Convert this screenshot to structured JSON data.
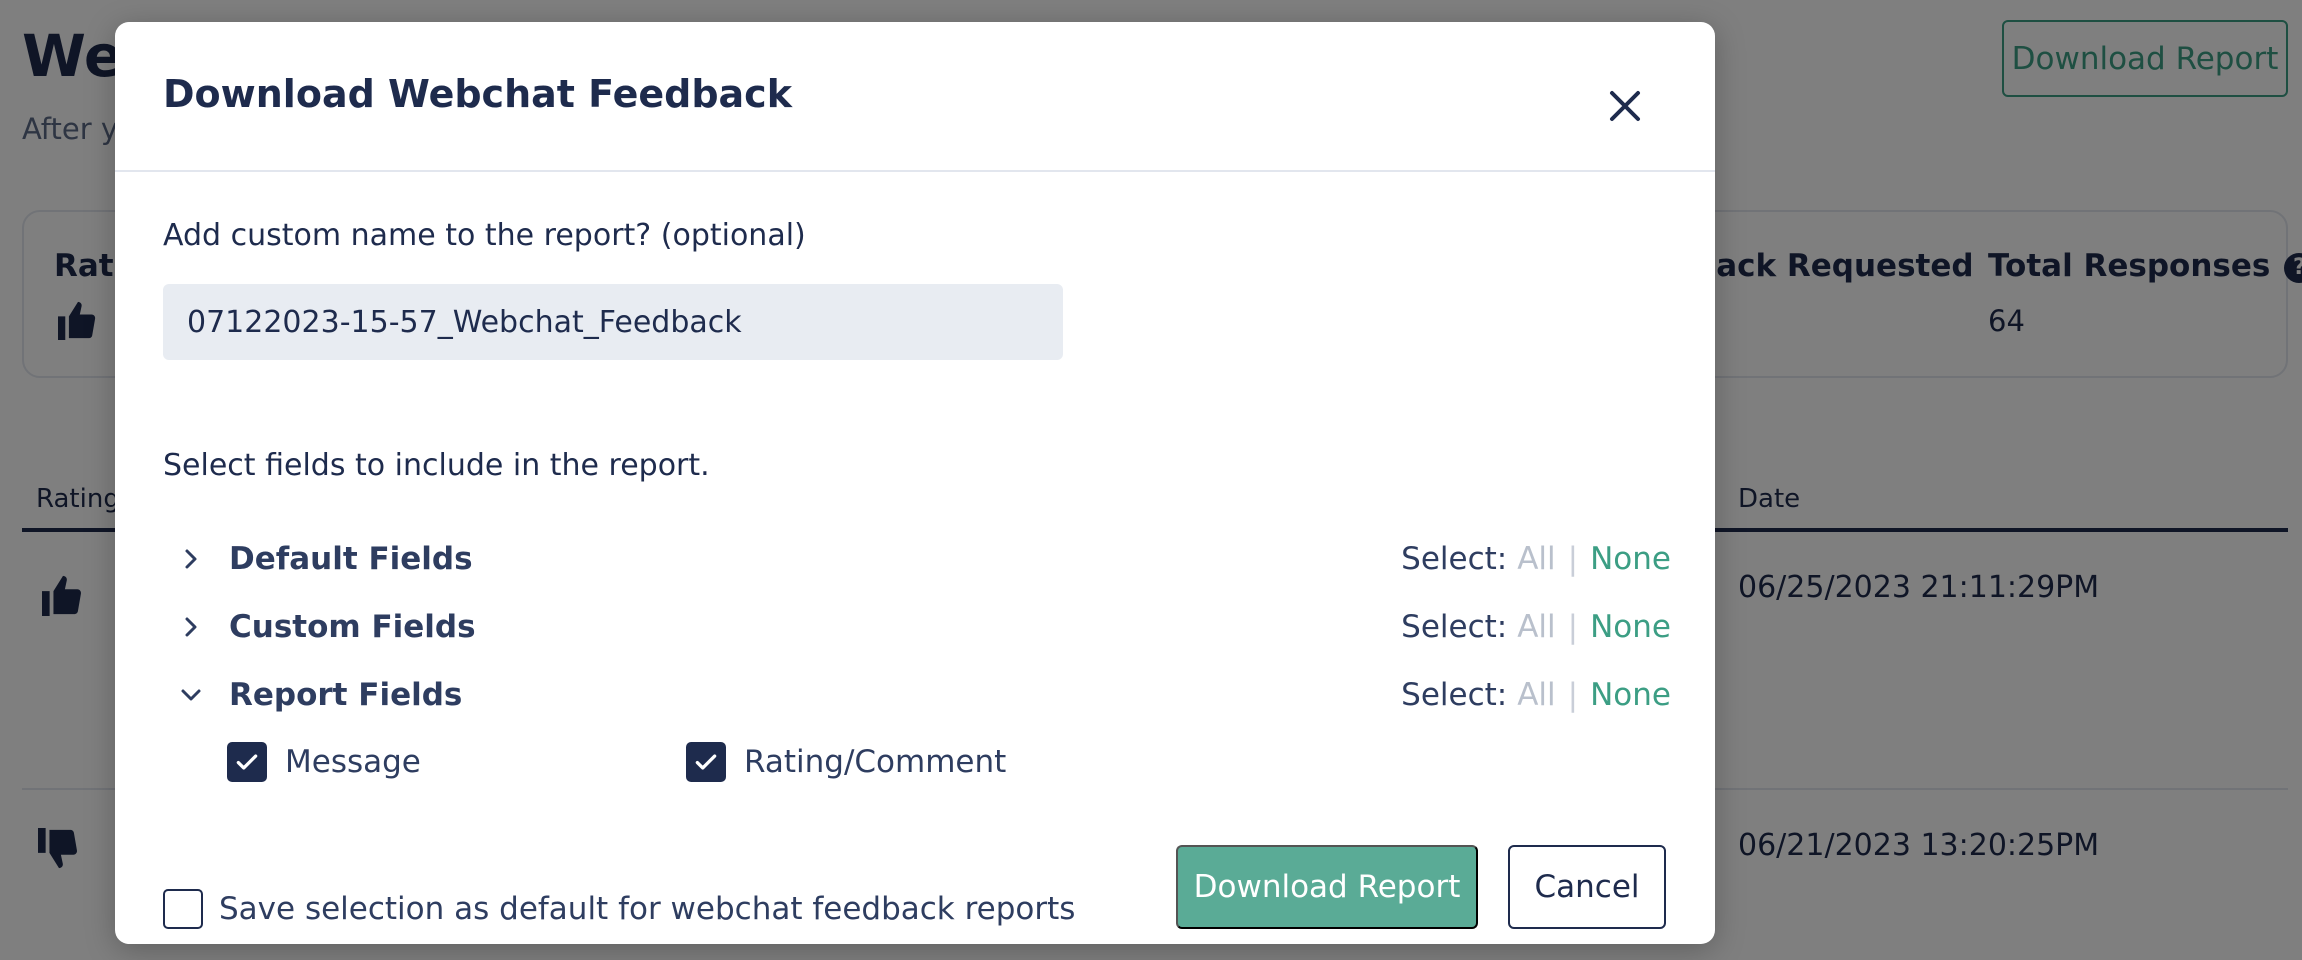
{
  "background": {
    "title": "Wel",
    "subtitle": "After yo",
    "download_button": "Download Report",
    "stats": {
      "rating_label": "Ratin",
      "feedback_requested_label": "back Requested",
      "total_responses_label": "Total Responses",
      "total_responses_value": "64"
    },
    "table": {
      "headers": {
        "rating": "Rating",
        "date": "Date"
      },
      "rows": [
        {
          "rating_icon": "thumbs-up-icon",
          "date": "06/25/2023 21:11:29PM"
        },
        {
          "rating_icon": "thumbs-down-icon",
          "date": "06/21/2023 13:20:25PM"
        }
      ]
    }
  },
  "modal": {
    "title": "Download Webchat Feedback",
    "custom_name_label": "Add custom name to the report? (optional)",
    "custom_name_value": "07122023-15-57_Webchat_Feedback",
    "select_fields_label": "Select fields to include in the report.",
    "select_prefix": "Select:",
    "select_all": "All",
    "select_none": "None",
    "groups": [
      {
        "name": "Default Fields",
        "expanded": false
      },
      {
        "name": "Custom Fields",
        "expanded": false
      },
      {
        "name": "Report Fields",
        "expanded": true
      }
    ],
    "report_fields": [
      {
        "label": "Message",
        "checked": true
      },
      {
        "label": "Rating/Comment",
        "checked": true
      }
    ],
    "save_default_label": "Save selection as default for webchat feedback reports",
    "save_default_checked": false,
    "download_button": "Download Report",
    "cancel_button": "Cancel"
  },
  "colors": {
    "navy": "#1e2b4d",
    "accent_green": "#5aab96",
    "link_green": "#3c9e84",
    "muted": "#b9c0cc"
  }
}
